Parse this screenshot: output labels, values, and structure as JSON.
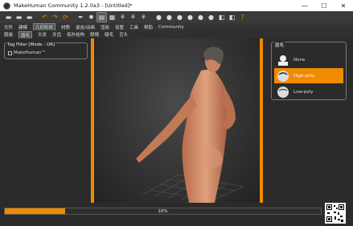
{
  "window": {
    "title": "MakeHuman Community 1.2.0a3 - [Untitled]*"
  },
  "titlebar_controls": {
    "minimize": "—",
    "maximize": "☐",
    "close": "✕"
  },
  "toolbar": {
    "buttons": [
      {
        "name": "toolbar-button-0",
        "glyph": "▬"
      },
      {
        "name": "toolbar-button-1",
        "glyph": "▬"
      },
      {
        "name": "toolbar-button-2",
        "glyph": "▬"
      },
      {
        "name": "undo-button",
        "glyph": "↶"
      },
      {
        "name": "redo-button",
        "glyph": "↷"
      },
      {
        "name": "reset-button",
        "glyph": "⟳"
      },
      {
        "name": "toolbar-button-6",
        "glyph": "✒"
      },
      {
        "name": "toolbar-button-7",
        "glyph": "✸"
      },
      {
        "name": "toolbar-button-8",
        "glyph": "▤"
      },
      {
        "name": "toolbar-button-9",
        "glyph": "▦"
      },
      {
        "name": "toolbar-button-10",
        "glyph": "⚘"
      },
      {
        "name": "toolbar-button-11",
        "glyph": "⚘"
      },
      {
        "name": "toolbar-button-12",
        "glyph": "⚘"
      },
      {
        "name": "toolbar-button-13",
        "glyph": "●"
      },
      {
        "name": "toolbar-button-14",
        "glyph": "●"
      },
      {
        "name": "toolbar-button-15",
        "glyph": "●"
      },
      {
        "name": "toolbar-button-16",
        "glyph": "●"
      },
      {
        "name": "toolbar-button-17",
        "glyph": "●"
      },
      {
        "name": "toolbar-button-18",
        "glyph": "●"
      },
      {
        "name": "toolbar-button-19",
        "glyph": "◧"
      },
      {
        "name": "toolbar-button-20",
        "glyph": "◧"
      },
      {
        "name": "help-button",
        "glyph": "?"
      }
    ]
  },
  "menubar": {
    "items": [
      "文件",
      "建模",
      "几何形状",
      "材质",
      "姿态/动画",
      "渲染",
      "设置",
      "工具",
      "帮助",
      "Community"
    ],
    "active_index": 2
  },
  "subtabs": {
    "items": [
      "服装",
      "眉毛",
      "头发",
      "牙齿",
      "拓扑结构",
      "眼睛",
      "睫毛",
      "舌头"
    ],
    "active_index": 1
  },
  "left_panel": {
    "tag_filter_title": "Tag Filter [Mode : OR]",
    "tag_makehuman": "MakeHuman™"
  },
  "right_panel": {
    "group_title": "眉毛",
    "options": [
      {
        "label": "None",
        "selected": false
      },
      {
        "label": "High-poly",
        "selected": true
      },
      {
        "label": "Low-poly",
        "selected": false
      }
    ]
  },
  "status": {
    "progress_text": "10%",
    "progress_fraction": 0.19
  },
  "colors": {
    "accent": "#f08a00",
    "background": "#2b2b2b"
  }
}
